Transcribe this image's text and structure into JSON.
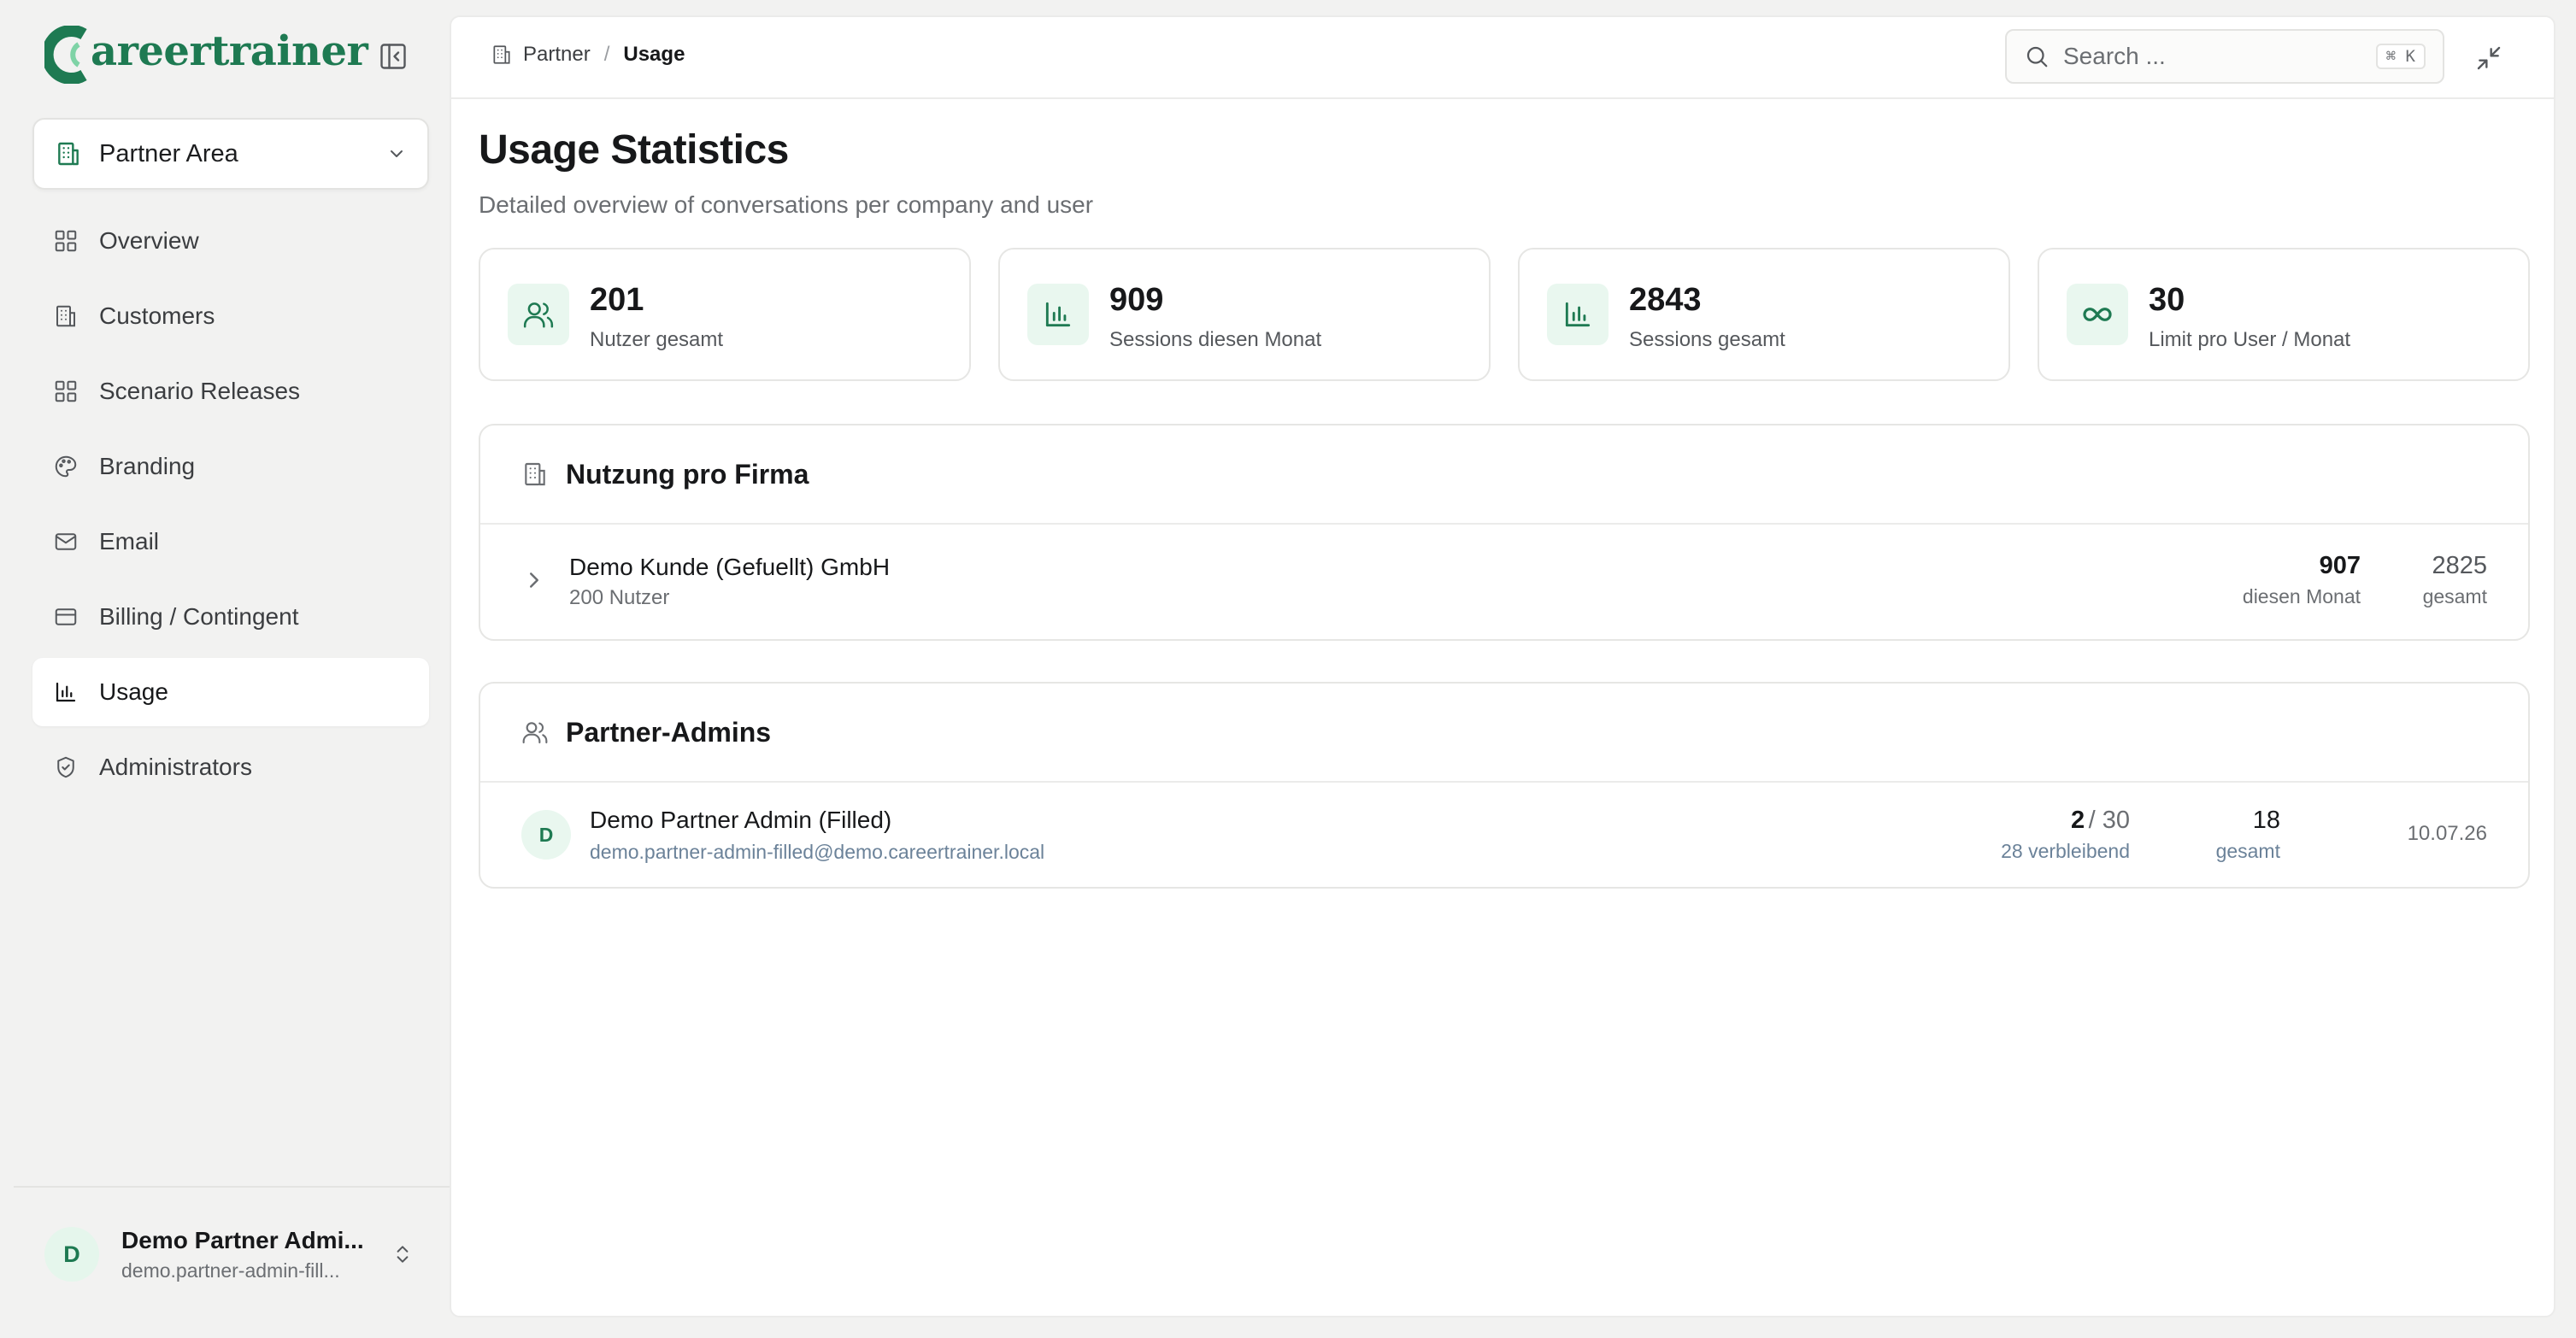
{
  "brand": {
    "name": "areertrainer",
    "accent": "#1e7a52",
    "accent_light": "#e9f7ef"
  },
  "sidebar": {
    "area_selector": {
      "label": "Partner Area",
      "icon": "building-icon"
    },
    "items": [
      {
        "label": "Overview",
        "icon": "grid-icon",
        "active": false
      },
      {
        "label": "Customers",
        "icon": "building-icon",
        "active": false
      },
      {
        "label": "Scenario Releases",
        "icon": "grid-icon",
        "active": false
      },
      {
        "label": "Branding",
        "icon": "palette-icon",
        "active": false
      },
      {
        "label": "Email",
        "icon": "mail-icon",
        "active": false
      },
      {
        "label": "Billing / Contingent",
        "icon": "credit-card-icon",
        "active": false
      },
      {
        "label": "Usage",
        "icon": "bar-chart-icon",
        "active": true
      },
      {
        "label": "Administrators",
        "icon": "shield-icon",
        "active": false
      }
    ],
    "user": {
      "initial": "D",
      "name": "Demo Partner Admi...",
      "email": "demo.partner-admin-fill..."
    }
  },
  "topbar": {
    "breadcrumb": {
      "parent": "Partner",
      "separator": "/",
      "current": "Usage"
    },
    "search": {
      "placeholder": "Search ...",
      "shortcut": "⌘ K"
    }
  },
  "page": {
    "title": "Usage Statistics",
    "subtitle": "Detailed overview of conversations per company and user"
  },
  "stats": [
    {
      "value": "201",
      "label": "Nutzer gesamt",
      "icon": "users-icon"
    },
    {
      "value": "909",
      "label": "Sessions diesen Monat",
      "icon": "bar-chart-icon"
    },
    {
      "value": "2843",
      "label": "Sessions gesamt",
      "icon": "bar-chart-icon"
    },
    {
      "value": "30",
      "label": "Limit pro User / Monat",
      "icon": "infinity-icon"
    }
  ],
  "company_usage": {
    "title": "Nutzung pro Firma",
    "rows": [
      {
        "name": "Demo Kunde (Gefuellt) GmbH",
        "users": "200 Nutzer",
        "month_value": "907",
        "month_label": "diesen Monat",
        "total_value": "2825",
        "total_label": "gesamt"
      }
    ]
  },
  "partner_admins": {
    "title": "Partner-Admins",
    "rows": [
      {
        "initial": "D",
        "name": "Demo Partner Admin (Filled)",
        "email": "demo.partner-admin-filled@demo.careertrainer.local",
        "used": "2",
        "limit": "/ 30",
        "remaining": "28 verbleibend",
        "total_value": "18",
        "total_label": "gesamt",
        "date": "10.07.26"
      }
    ]
  }
}
